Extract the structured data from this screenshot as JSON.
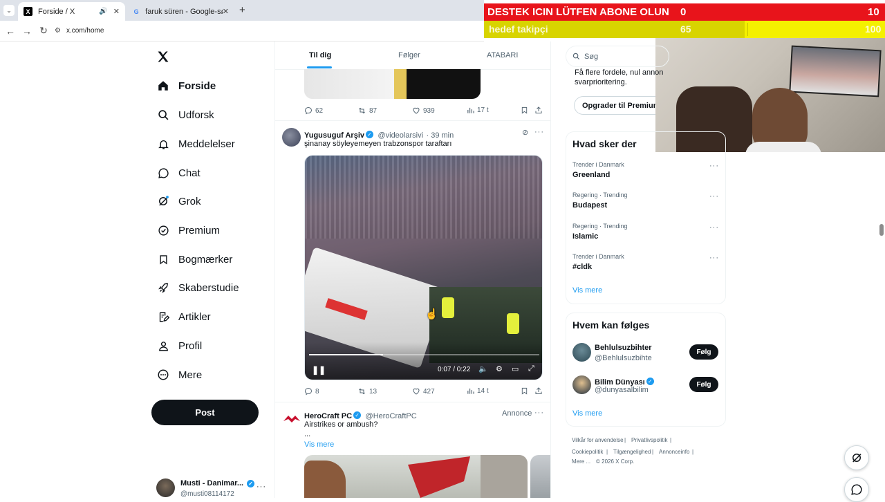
{
  "browser": {
    "tabs": [
      {
        "title": "Forside / X",
        "active": true
      },
      {
        "title": "faruk süren - Google-søgning",
        "active": false
      }
    ],
    "url": "x.com/home"
  },
  "overlay": {
    "line1": {
      "label": "DESTEK ICIN LÜTFEN ABONE OLUN",
      "current": "0",
      "target": "10"
    },
    "line2": {
      "label": "hedef takipçi",
      "current": "65",
      "target": "100",
      "progress": 0.65
    }
  },
  "nav": {
    "items": [
      {
        "label": "Forside",
        "icon": "home-icon"
      },
      {
        "label": "Udforsk",
        "icon": "search-icon"
      },
      {
        "label": "Meddelelser",
        "icon": "bell-icon"
      },
      {
        "label": "Chat",
        "icon": "chat-icon"
      },
      {
        "label": "Grok",
        "icon": "grok-icon"
      },
      {
        "label": "Premium",
        "icon": "premium-icon"
      },
      {
        "label": "Bogmærker",
        "icon": "bookmark-icon"
      },
      {
        "label": "Skaberstudie",
        "icon": "rocket-icon"
      },
      {
        "label": "Artikler",
        "icon": "article-icon"
      },
      {
        "label": "Profil",
        "icon": "profile-icon"
      },
      {
        "label": "Mere",
        "icon": "more-icon"
      }
    ],
    "post_label": "Post",
    "account": {
      "name": "Musti - Danimar...",
      "handle": "@musti08114172"
    }
  },
  "feed": {
    "tabs": [
      "Til dig",
      "Følger",
      "ATABARI"
    ],
    "post0_actions": {
      "replies": "62",
      "reposts": "87",
      "likes": "939",
      "views": "17 t"
    },
    "post1": {
      "name": "Yugusuguf Arşiv",
      "handle": "@videolarsivi",
      "time": "· 39 min",
      "text": "şinanay söyleyemeyen trabzonspor taraftarı",
      "video_time": "0:07 / 0:22",
      "video_progress": 0.32,
      "replies": "8",
      "reposts": "13",
      "likes": "427",
      "views": "14 t"
    },
    "post2": {
      "name": "HeroCraft PC",
      "handle": "@HeroCraftPC",
      "ad_label": "Annonce",
      "text": "Airstrikes or ambush?",
      "ellipsis": "...",
      "more_label": "Vis mere"
    }
  },
  "sidebar": {
    "search_placeholder": "Søg",
    "premium_text_1": "Få flere fordele, nul annon",
    "premium_text_2": "svarprioritering.",
    "premium_button": "Opgrader til Premium+",
    "trends_title": "Hvad sker der",
    "trends": [
      {
        "meta": "Trender i Danmark",
        "name": "Greenland"
      },
      {
        "meta": "Regering · Trending",
        "name": "Budapest"
      },
      {
        "meta": "Regering · Trending",
        "name": "Islamic"
      },
      {
        "meta": "Trender i Danmark",
        "name": "#cldk"
      }
    ],
    "trends_more": "Vis mere",
    "follow_title": "Hvem kan følges",
    "follow": [
      {
        "name": "Behlulsuzbihter",
        "handle": "@Behlulsuzbihte",
        "verified": false
      },
      {
        "name": "Bilim Dünyası",
        "handle": "@dunyasalbilim",
        "verified": true
      }
    ],
    "follow_label": "Følg",
    "follow_more": "Vis mere",
    "footer": [
      "Vilkår for anvendelse",
      "|",
      "Privatlivspolitik",
      "|",
      "Cookiepolitik",
      "|",
      "Tilgængelighed",
      "|",
      "Annonceinfo",
      "|",
      "Mere ...",
      "© 2026 X Corp."
    ]
  },
  "colors": {
    "accent": "#1d9bf0",
    "overlay_red": "#e8141b",
    "overlay_yellow": "#f4f000"
  }
}
